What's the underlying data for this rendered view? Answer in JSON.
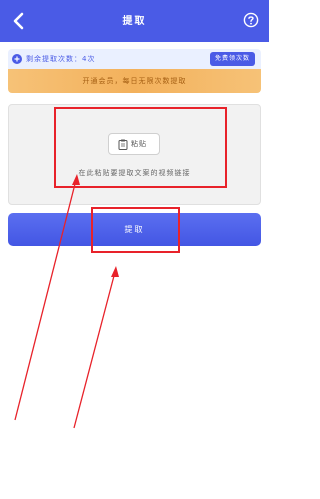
{
  "header": {
    "title": "提取",
    "back_icon": "chevron-left-icon",
    "help_icon": "question-circle-icon",
    "background_color": "#4a5be6"
  },
  "remain": {
    "label": "剩余提取次数：",
    "count": "4次",
    "get_more_label": "免费领次数"
  },
  "vip_banner": {
    "text": "开通会员，每日无限次数提取"
  },
  "paste_area": {
    "paste_button_label": "粘贴",
    "hint": "在此粘贴要提取文案的视频链接"
  },
  "extract_button": {
    "label": "提取"
  },
  "annotation_color": "#e8222a"
}
